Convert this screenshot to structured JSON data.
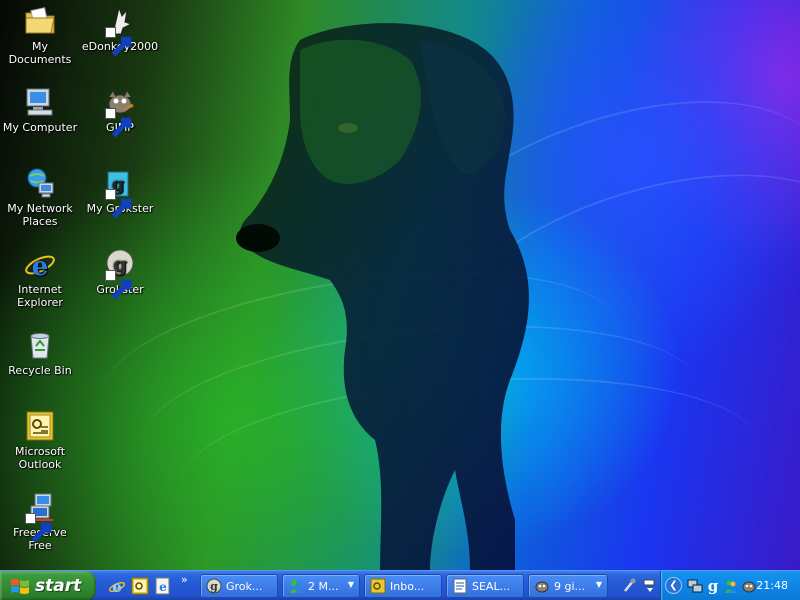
{
  "desktop": {
    "icons": [
      {
        "label": "My Documents",
        "icon": "folder-documents-icon"
      },
      {
        "label": "eDonkey2000",
        "icon": "edonkey-icon"
      },
      {
        "label": "My Computer",
        "icon": "computer-icon"
      },
      {
        "label": "GIMP",
        "icon": "gimp-icon"
      },
      {
        "label": "My Network Places",
        "icon": "network-places-icon"
      },
      {
        "label": "My Grokster",
        "icon": "my-grokster-icon"
      },
      {
        "label": "Internet Explorer",
        "icon": "internet-explorer-icon"
      },
      {
        "label": "Grokster",
        "icon": "grokster-icon"
      },
      {
        "label": "Recycle Bin",
        "icon": "recycle-bin-icon"
      },
      {
        "label": "Microsoft Outlook",
        "icon": "outlook-icon"
      },
      {
        "label": "Freeserve Free",
        "icon": "freeserve-icon"
      }
    ]
  },
  "taskbar": {
    "start_label": "start",
    "quick_launch_more": "»",
    "tasks": [
      {
        "label": "Grok...",
        "icon": "grokster-icon"
      },
      {
        "label": "2 M...",
        "icon": "messenger-icon"
      },
      {
        "label": "Inbo...",
        "icon": "outlook-icon"
      },
      {
        "label": "SEAL...",
        "icon": "document-icon"
      },
      {
        "label": "9 gi...",
        "icon": "gimp-icon"
      }
    ],
    "tray": {
      "clock": "21:48"
    }
  },
  "colors": {
    "taskbar_blue": "#2458d4",
    "start_green": "#318a31",
    "tray_blue": "#0e86e6"
  }
}
